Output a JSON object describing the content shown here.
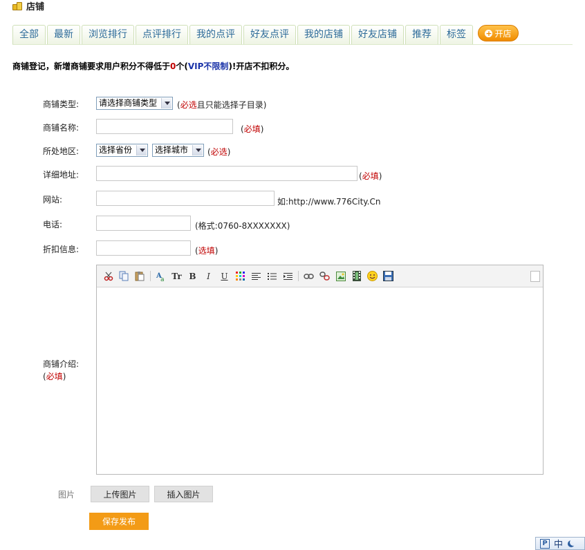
{
  "header": {
    "title": "店铺"
  },
  "tabs": [
    "全部",
    "最新",
    "浏览排行",
    "点评排行",
    "我的点评",
    "好友点评",
    "我的店铺",
    "好友店铺",
    "推荐",
    "标签"
  ],
  "open_shop_label": "开店",
  "notice": {
    "part1": "商铺登记，新增商铺要求用户积分不得低于",
    "count": "0",
    "part2": "个(",
    "vip": "VIP不限制",
    "part3": ")!开店不扣积分。"
  },
  "form": {
    "type_label": "商铺类型:",
    "type_select": "请选择商铺类型",
    "type_hint_open": "(",
    "type_hint_required": "必选",
    "type_hint_rest": "且只能选择子目录)",
    "name_label": "商铺名称:",
    "name_hint": "必填",
    "region_label": "所处地区:",
    "province_select": "选择省份",
    "city_select": "选择城市",
    "region_hint": "必选",
    "address_label": "详细地址:",
    "address_hint": "必填",
    "site_label": "网站:",
    "site_hint": "如:http://www.776City.Cn",
    "phone_label": "电话:",
    "phone_hint": "(格式:0760-8XXXXXXX)",
    "discount_label": "折扣信息:",
    "discount_hint": "选填",
    "intro_label": "商铺介绍:",
    "intro_hint": "必填"
  },
  "editor": {
    "tools": [
      "cut-icon",
      "copy-icon",
      "paste-icon",
      "font-icon",
      "font-size-icon",
      "bold-icon",
      "italic-icon",
      "underline-icon",
      "color-icon",
      "align-icon",
      "bullet-list-icon",
      "indent-icon",
      "link-icon",
      "unlink-icon",
      "image-icon",
      "video-icon",
      "emoticon-icon",
      "save-icon"
    ],
    "text_tools": {
      "font_size": "Tr",
      "bold": "B",
      "italic": "I",
      "underline": "U"
    }
  },
  "images": {
    "label": "图片",
    "upload_button": "上传图片",
    "insert_button": "插入图片"
  },
  "submit_button": "保存发布",
  "ime": {
    "mode": "中"
  },
  "colors": {
    "tab_text": "#2d6b99",
    "accent_orange": "#f39b16",
    "required_red": "#c00000",
    "vip_blue": "#1a33a8"
  }
}
